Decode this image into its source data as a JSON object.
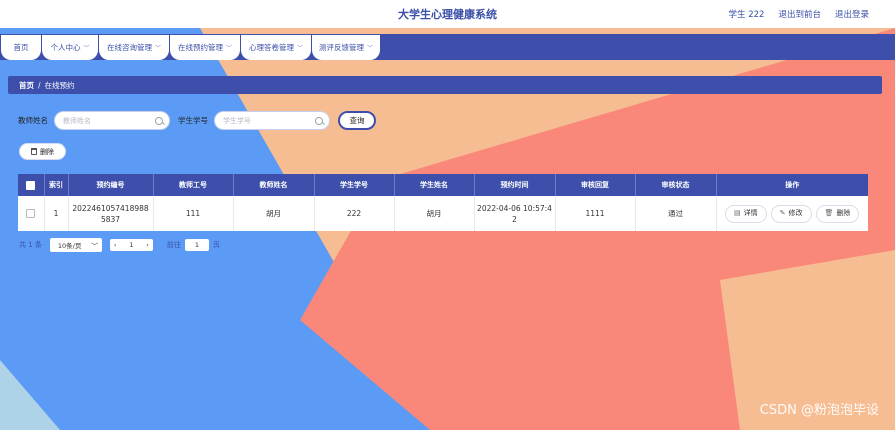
{
  "header": {
    "title": "大学生心理健康系统",
    "user_label": "学生 222",
    "back_label": "退出到前台",
    "logout_label": "退出登录"
  },
  "nav": [
    {
      "label": "首页",
      "has_menu": false
    },
    {
      "label": "个人中心",
      "has_menu": true
    },
    {
      "label": "在线咨询管理",
      "has_menu": true
    },
    {
      "label": "在线预约管理",
      "has_menu": true
    },
    {
      "label": "心理答卷管理",
      "has_menu": true
    },
    {
      "label": "测评反馈管理",
      "has_menu": true
    }
  ],
  "breadcrumb": {
    "home": "首页",
    "separator": "/",
    "current": "在线预约"
  },
  "search": {
    "teacher_label": "教师姓名",
    "teacher_placeholder": "教师姓名",
    "student_label": "学生学号",
    "student_placeholder": "学生学号",
    "query_label": "查询"
  },
  "delete_label": "删除",
  "table": {
    "columns": [
      "索引",
      "预约编号",
      "教师工号",
      "教师姓名",
      "学生学号",
      "学生姓名",
      "预约时间",
      "审核回复",
      "审核状态",
      "操作"
    ],
    "rows": [
      {
        "index": "1",
        "booking_no_line1": "2022461057418988",
        "booking_no_line2": "5837",
        "teacher_id": "111",
        "teacher_name": "胡月",
        "student_id": "222",
        "student_name": "胡月",
        "time_line1": "2022-04-06 10:57:4",
        "time_line2": "2",
        "reply": "1111",
        "status": "通过",
        "actions": {
          "detail": "详情",
          "edit": "修改",
          "delete": "删除"
        }
      }
    ]
  },
  "pager": {
    "total": "共 1 条",
    "page_size": "10条/页",
    "current_page": "1",
    "goto_label": "前往",
    "goto_value": "1",
    "page_unit": "页"
  },
  "watermark": "CSDN @粉泡泡毕设",
  "colors": {
    "primary": "#3d4fab",
    "bg_blue": "#5b9bf5",
    "bg_peach": "#f6bd92",
    "bg_coral": "#f9887a"
  }
}
